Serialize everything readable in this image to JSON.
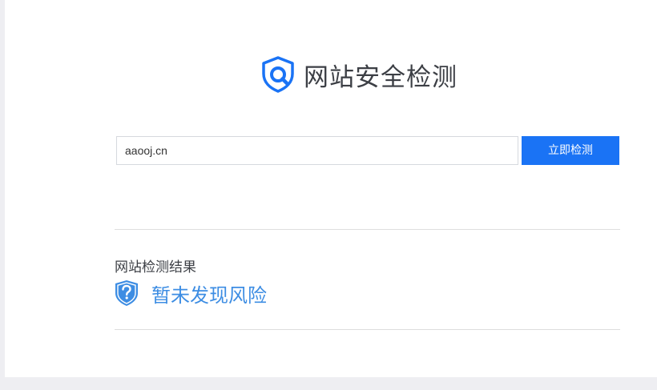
{
  "header": {
    "title": "网站安全检测",
    "logo_icon": "shield-search-icon"
  },
  "search": {
    "value": "aaooj.cn",
    "button_label": "立即检测"
  },
  "result": {
    "title": "网站检测结果",
    "status": "暂未发现风险",
    "status_icon": "shield-question-icon",
    "status_color": "#3d8de3"
  },
  "colors": {
    "accent": "#1a73f5",
    "background": "#eeeef2"
  }
}
